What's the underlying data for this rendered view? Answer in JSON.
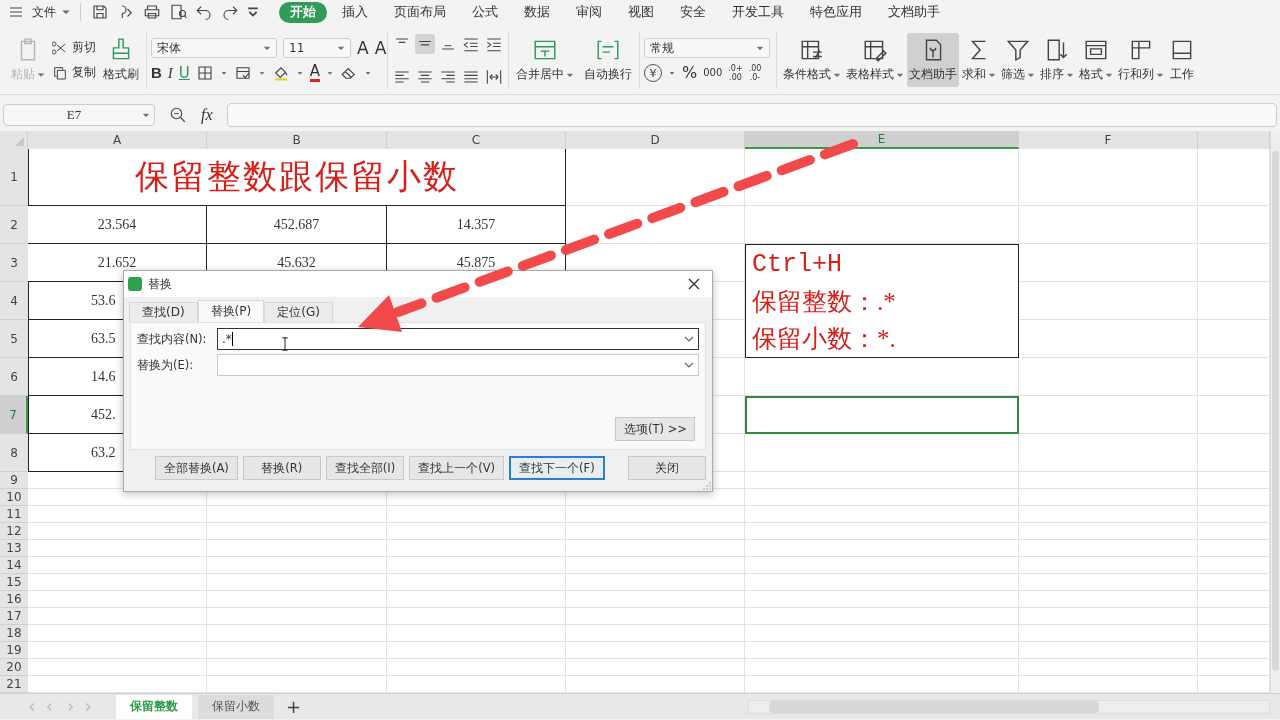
{
  "menu_bar": {
    "file_menu": "文件",
    "tabs": [
      {
        "label": "开始",
        "selected": true
      },
      {
        "label": "插入",
        "selected": false
      },
      {
        "label": "页面布局",
        "selected": false
      },
      {
        "label": "公式",
        "selected": false
      },
      {
        "label": "数据",
        "selected": false
      },
      {
        "label": "审阅",
        "selected": false
      },
      {
        "label": "视图",
        "selected": false
      },
      {
        "label": "安全",
        "selected": false
      },
      {
        "label": "开发工具",
        "selected": false
      },
      {
        "label": "特色应用",
        "selected": false
      },
      {
        "label": "文档助手",
        "selected": false
      }
    ]
  },
  "ribbon": {
    "clipboard": {
      "paste": {
        "label": "粘贴",
        "disabled": true
      },
      "cut": "剪切",
      "copy": "复制",
      "format_painter": "格式刷"
    },
    "font": {
      "name": "宋体",
      "size": "11",
      "grow": "A",
      "shrink": "A",
      "styles": [
        "B",
        "I",
        "U"
      ],
      "font_color": "A"
    },
    "alignment": [
      {
        "label": "合并居中",
        "dropdown": true
      },
      {
        "label": "自动换行",
        "dropdown": false
      }
    ],
    "number": {
      "format": "常规",
      "currency": "¥",
      "percent": "%",
      "thousands": "000",
      "increase_decimal": [
        ".0+",
        ".00"
      ],
      "decrease_decimal": [
        ".00",
        ".0-"
      ]
    },
    "tools": [
      {
        "label": "条件格式",
        "dropdown": true,
        "pressed": false
      },
      {
        "label": "表格样式",
        "dropdown": true,
        "pressed": false
      },
      {
        "label": "文档助手",
        "dropdown": false,
        "pressed": true
      },
      {
        "label": "求和",
        "dropdown": true,
        "pressed": false
      },
      {
        "label": "筛选",
        "dropdown": true,
        "pressed": false
      },
      {
        "label": "排序",
        "dropdown": true,
        "pressed": false
      },
      {
        "label": "格式",
        "dropdown": true,
        "pressed": false
      },
      {
        "label": "行和列",
        "dropdown": true,
        "pressed": false
      },
      {
        "label": "工作",
        "dropdown": false,
        "pressed": false
      }
    ]
  },
  "formula_bar": {
    "name_box": "E7",
    "fx": "fx"
  },
  "sheet": {
    "columns": [
      {
        "label": "A",
        "selected": false
      },
      {
        "label": "B",
        "selected": false
      },
      {
        "label": "C",
        "selected": false
      },
      {
        "label": "D",
        "selected": false
      },
      {
        "label": "E",
        "selected": true
      },
      {
        "label": "F",
        "selected": false
      }
    ],
    "rows": [
      {
        "label": "1",
        "selected": false
      },
      {
        "label": "2",
        "selected": false
      },
      {
        "label": "3",
        "selected": false
      },
      {
        "label": "4",
        "selected": false
      },
      {
        "label": "5",
        "selected": false
      },
      {
        "label": "6",
        "selected": false
      },
      {
        "label": "7",
        "selected": true
      },
      {
        "label": "8",
        "selected": false
      },
      {
        "label": "9",
        "selected": false
      },
      {
        "label": "10",
        "selected": false
      },
      {
        "label": "11",
        "selected": false
      },
      {
        "label": "12",
        "selected": false
      },
      {
        "label": "13",
        "selected": false
      },
      {
        "label": "14",
        "selected": false
      },
      {
        "label": "15",
        "selected": false
      },
      {
        "label": "16",
        "selected": false
      },
      {
        "label": "17",
        "selected": false
      },
      {
        "label": "18",
        "selected": false
      },
      {
        "label": "19",
        "selected": false
      },
      {
        "label": "20",
        "selected": false
      },
      {
        "label": "21",
        "selected": false
      }
    ],
    "title": "保留整数跟保留小数",
    "data": [
      [
        "23.564",
        "452.687",
        "14.357"
      ],
      [
        "21.652",
        "45.632",
        "45.875"
      ],
      [
        "53.6"
      ],
      [
        "63.5"
      ],
      [
        "14.6"
      ],
      [
        "452."
      ],
      [
        "63.2"
      ]
    ],
    "note": [
      "Ctrl+H",
      "保留整数：.*",
      "保留小数：*."
    ]
  },
  "dialog": {
    "title": "替换",
    "tabs": [
      {
        "label": "查找(D)",
        "selected": false
      },
      {
        "label": "替换(P)",
        "selected": true
      },
      {
        "label": "定位(G)",
        "selected": false
      }
    ],
    "fields": [
      {
        "label": "查找内容(N):",
        "value": ".*"
      },
      {
        "label": "替换为(E):"
      }
    ],
    "options_button": "选项(T) >>",
    "buttons": [
      {
        "label": "全部替换(A)",
        "default": false
      },
      {
        "label": "替换(R)",
        "default": false
      },
      {
        "label": "查找全部(I)",
        "default": false
      },
      {
        "label": "查找上一个(V)",
        "default": false
      },
      {
        "label": "查找下一个(F)",
        "default": true
      },
      {
        "label": "关闭",
        "default": false
      }
    ]
  },
  "sheet_tabs": {
    "tabs": [
      {
        "label": "保留整数",
        "selected": true
      },
      {
        "label": "保留小数",
        "selected": false
      }
    ],
    "add": "+"
  }
}
